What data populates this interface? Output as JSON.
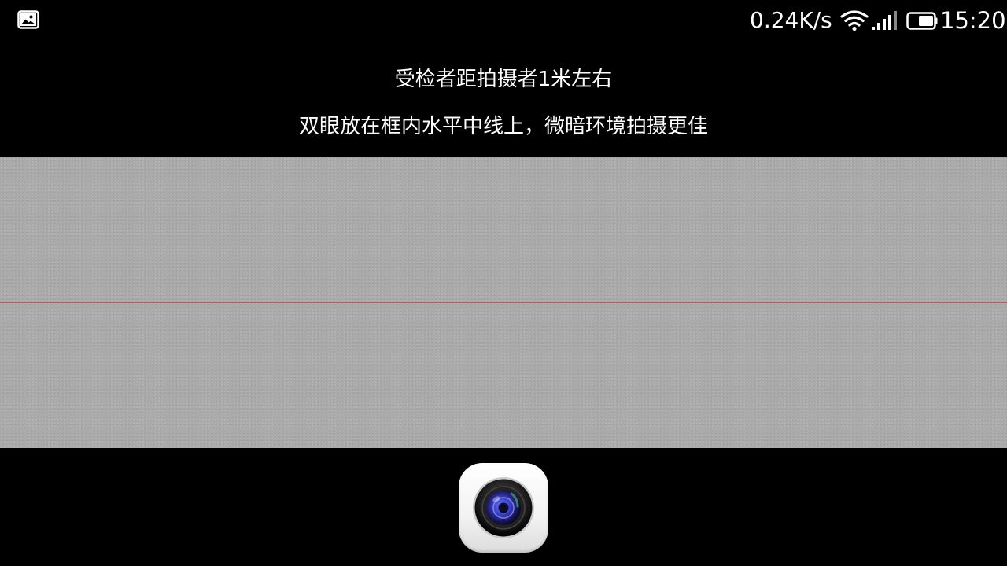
{
  "status_bar": {
    "notification_icon": "image-notification-icon",
    "network_speed": "0.24K/s",
    "wifi_icon": "wifi-icon",
    "signal_icon": "signal-icon",
    "battery_icon": "battery-icon",
    "battery_level": 0.6,
    "time": "15:20"
  },
  "instructions": {
    "line1": "受检者距拍摄者1米左右",
    "line2": "双眼放在框内水平中线上，微暗环境拍摄更佳"
  },
  "preview": {
    "center_line_color": "#d05050",
    "background_color": "#aaaaaa"
  },
  "controls": {
    "shutter_icon": "camera-lens-icon"
  }
}
